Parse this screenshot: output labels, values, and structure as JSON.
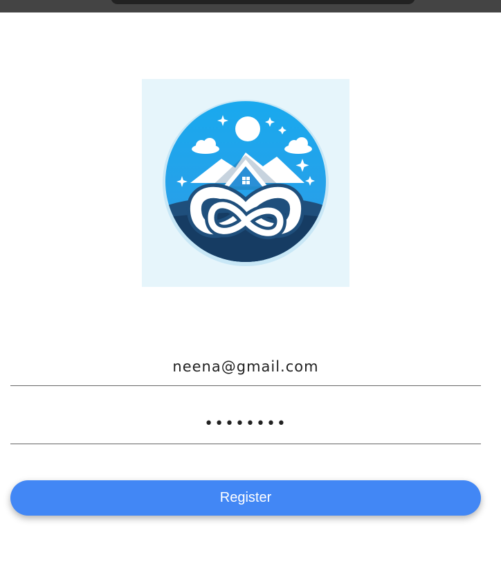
{
  "login_form": {
    "email_value": "neena@gmail.com",
    "password_value": "••••••••",
    "register_label": "Register"
  },
  "logo": {
    "icon": "infinity-house-mountains-logo"
  },
  "colors": {
    "button": "#4287f5",
    "logo_background": "#e6f5fb",
    "logo_sky": "#1eaaf0",
    "logo_navy": "#1f4f7c"
  }
}
